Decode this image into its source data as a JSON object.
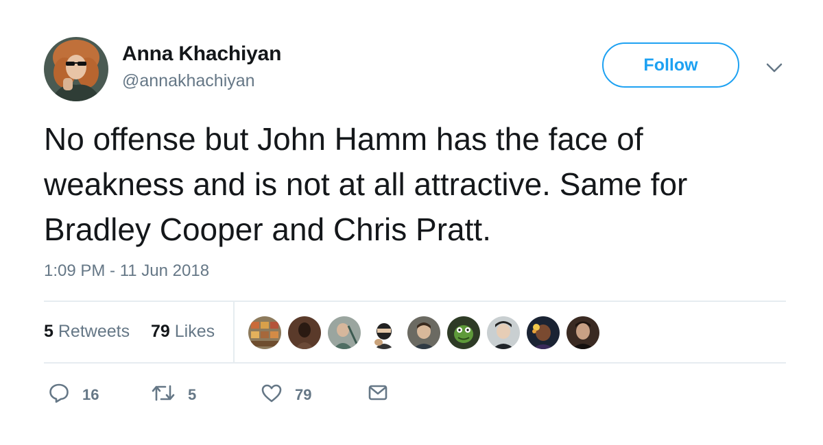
{
  "author": {
    "name": "Anna Khachiyan",
    "handle": "@annakhachiyan",
    "avatar_icon": "profile-photo"
  },
  "follow_button": {
    "label": "Follow",
    "color": "#1da1f2"
  },
  "menu_caret_icon": "chevron-down-icon",
  "tweet": {
    "text": "No offense but John Hamm has the face of weakness and is not at all attractive. Same for Bradley Cooper and Chris Pratt.",
    "timestamp": "1:09 PM - 11 Jun 2018"
  },
  "stats": {
    "retweets_count": "5",
    "retweets_label": "Retweets",
    "likes_count": "79",
    "likes_label": "Likes"
  },
  "likers": [
    {
      "icon": "liker-avatar"
    },
    {
      "icon": "liker-avatar"
    },
    {
      "icon": "liker-avatar"
    },
    {
      "icon": "liker-avatar"
    },
    {
      "icon": "liker-avatar"
    },
    {
      "icon": "liker-avatar"
    },
    {
      "icon": "liker-avatar"
    },
    {
      "icon": "liker-avatar"
    },
    {
      "icon": "liker-avatar"
    }
  ],
  "actions": {
    "reply_icon": "reply-icon",
    "reply_count": "16",
    "retweet_icon": "retweet-icon",
    "retweet_count": "5",
    "like_icon": "heart-icon",
    "like_count": "79",
    "dm_icon": "envelope-icon"
  },
  "colors": {
    "text": "#14171a",
    "secondary": "#657786",
    "divider": "#e6ecf0",
    "accent": "#1da1f2"
  }
}
